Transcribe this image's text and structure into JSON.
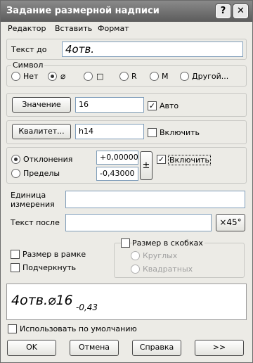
{
  "window": {
    "title": "Задание размерной надписи",
    "help_btn": "?",
    "close_btn": "✕"
  },
  "menu": [
    "Редактор",
    "Вставить",
    "Формат"
  ],
  "text_before": {
    "label": "Текст до",
    "value": "4отв."
  },
  "symbol": {
    "legend": "Символ",
    "options": [
      {
        "label": "Нет",
        "selected": false
      },
      {
        "label": "⌀",
        "selected": true
      },
      {
        "label": "□",
        "selected": false
      },
      {
        "label": "R",
        "selected": false
      },
      {
        "label": "M",
        "selected": false
      },
      {
        "label": "Другой...",
        "selected": false
      }
    ]
  },
  "value_row": {
    "button": "Значение",
    "value": "16",
    "auto_label": "Авто",
    "auto_checked": true
  },
  "qualitet_row": {
    "button": "Квалитет...",
    "value": "h14",
    "enable_label": "Включить",
    "enable_checked": false
  },
  "deviations": {
    "option1": "Отклонения",
    "option2": "Пределы",
    "option1_selected": true,
    "upper": "+0,00000",
    "lower": "-0,43000",
    "pm_button": "±",
    "enable_label": "Включить",
    "enable_checked": true
  },
  "unit": {
    "label": "Единица измерения",
    "value": ""
  },
  "text_after": {
    "label": "Текст после",
    "value": "",
    "angle_button": "×45°"
  },
  "options": {
    "frame": "Размер в рамке",
    "underline": "Подчеркнуть"
  },
  "brackets": {
    "label": "Размер в скобках",
    "round": "Круглых",
    "square": "Квадратных"
  },
  "preview": {
    "main": "4отв.⌀16",
    "sub": "-0,43"
  },
  "use_default": "Использовать по умолчанию",
  "buttons": {
    "ok": "OK",
    "cancel": "Отмена",
    "help": "Справка",
    "more": ">>"
  }
}
